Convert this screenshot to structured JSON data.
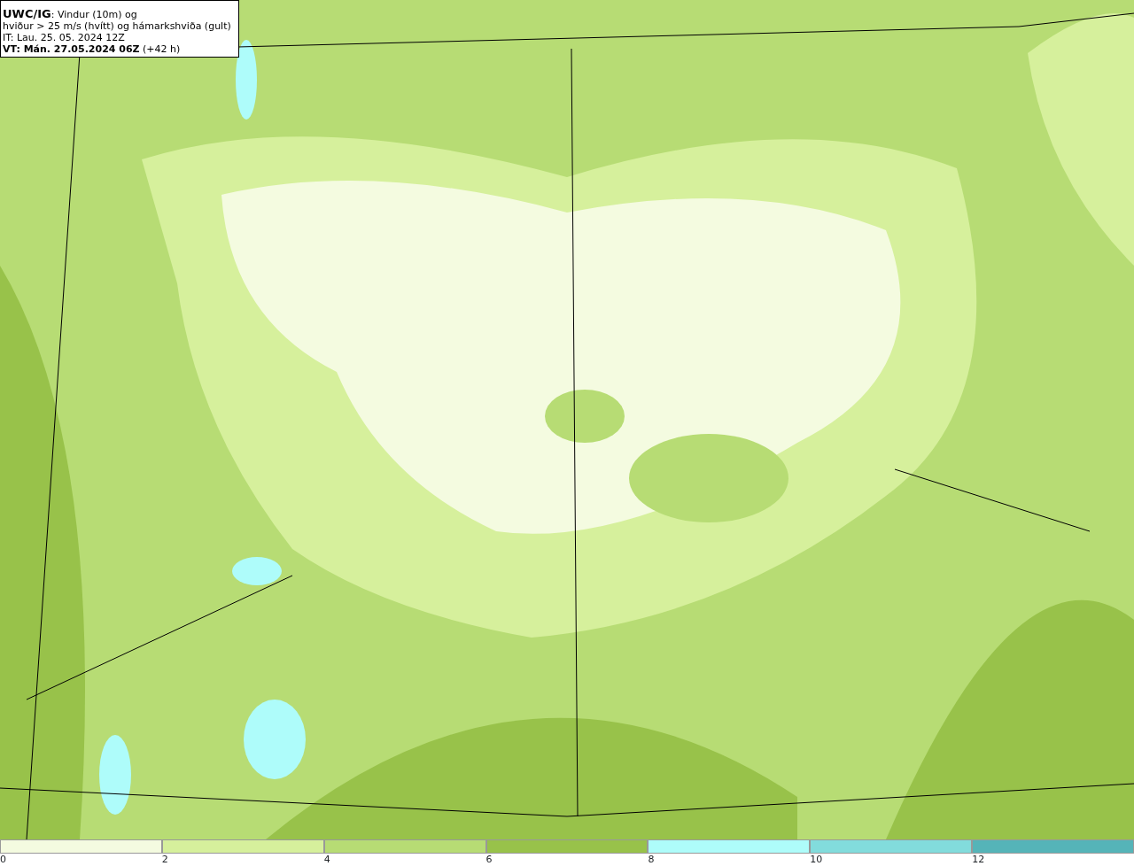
{
  "title_box": {
    "lines": [
      "**UWC/IG**: Vindur (10m) og",
      "hviður > 25 m/s (hvítt) og hámarkshviða (gult)",
      "IT: Lau. 25. 05. 2024 12Z",
      "**VT: Mán. 27.05.2024 06Z** (+42 h)"
    ]
  },
  "legend": {
    "bins": [
      {
        "color": "#f4fbe0"
      },
      {
        "color": "#d6f09c"
      },
      {
        "color": "#b7dc74"
      },
      {
        "color": "#98c24a"
      },
      {
        "color": "#aefcfa"
      },
      {
        "color": "#82dcdc"
      },
      {
        "color": "#55b4b8"
      }
    ],
    "ticks": [
      "0",
      "2",
      "4",
      "6",
      "8",
      "10",
      "12"
    ]
  }
}
